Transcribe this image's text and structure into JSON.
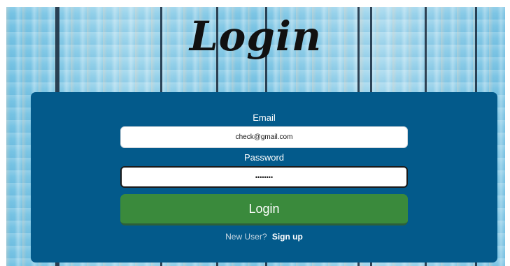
{
  "page": {
    "title": "Login"
  },
  "form": {
    "email_label": "Email",
    "email_value": "check@gmail.com",
    "password_label": "Password",
    "password_value": "••••••••",
    "login_button_label": "Login"
  },
  "footer": {
    "new_user_text": "New User?",
    "signup_link": "Sign up"
  },
  "colors": {
    "panel": "#035a8b",
    "login_button": "#3a8a3c",
    "background_wood": "#79c3e3"
  }
}
